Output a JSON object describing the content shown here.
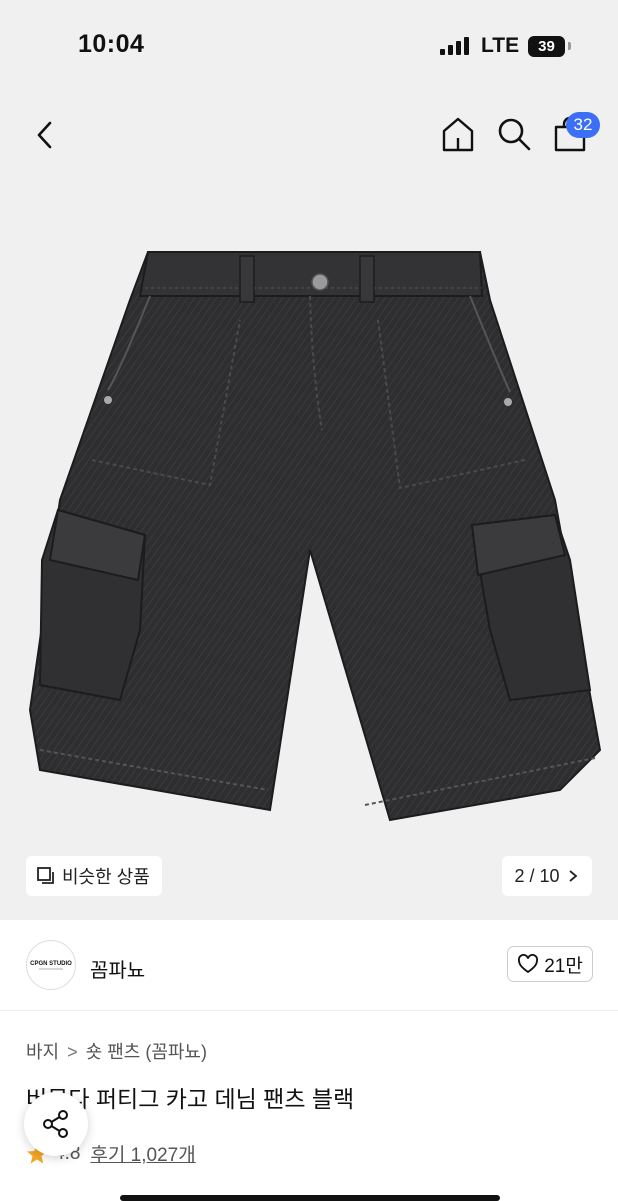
{
  "status_bar": {
    "time": "10:04",
    "network": "LTE",
    "battery": "39"
  },
  "header": {
    "cart_count": "32"
  },
  "gallery": {
    "similar_label": "비슷한 상품",
    "pager": "2 / 10"
  },
  "brand": {
    "name": "꼼파뇨",
    "logo_text": "CPGN STUDIO",
    "likes": "21만"
  },
  "product": {
    "breadcrumb": [
      "바지",
      "숏 팬츠 (꼼파뇨)"
    ],
    "title": "버뮤다 퍼티그 카고 데님 팬츠 블랙",
    "rating": "4.8",
    "reviews": "후기 1,027개"
  },
  "colors": {
    "accent": "#3b6ff5",
    "star": "#f5a623",
    "denim": "#2c2c2e"
  }
}
